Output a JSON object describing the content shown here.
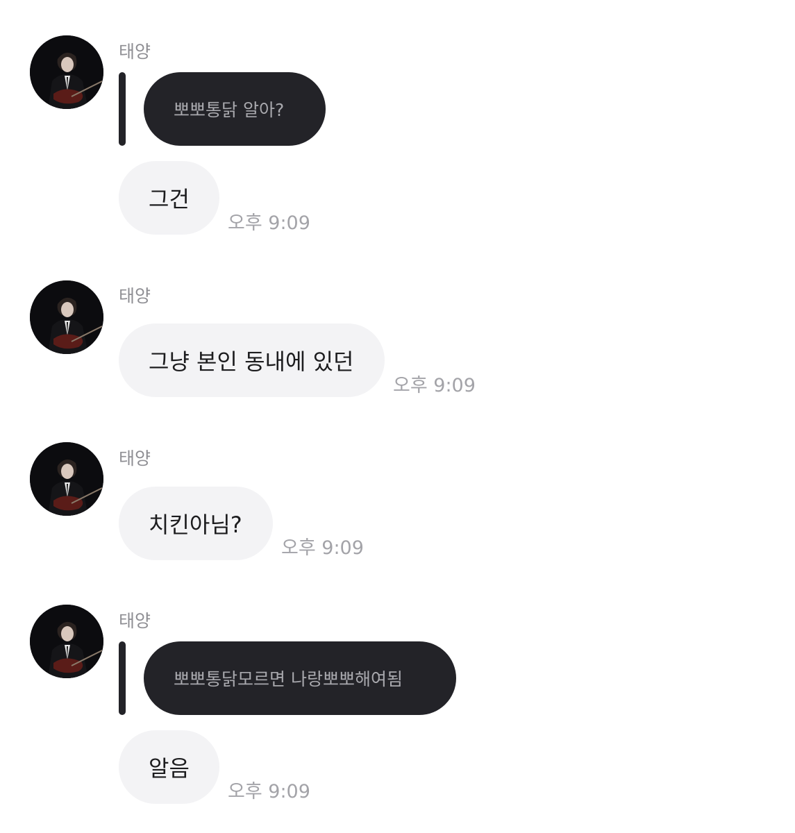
{
  "messages": [
    {
      "sender": "태양",
      "quote": "뽀뽀통닭 알아?",
      "text": "그건",
      "time": "오후 9:09"
    },
    {
      "sender": "태양",
      "text": "그냥 본인 동내에 있던",
      "time": "오후 9:09"
    },
    {
      "sender": "태양",
      "text": "치킨아님?",
      "time": "오후 9:09"
    },
    {
      "sender": "태양",
      "quote": "뽀뽀통닭모르면 나랑뽀뽀해여됨",
      "text": "알음",
      "time": "오후 9:09"
    }
  ],
  "colors": {
    "incoming_bubble": "#f3f3f5",
    "quote_bubble": "#232328",
    "timestamp": "#a3a3a8",
    "sender_name": "#8e8e93"
  },
  "icons": {
    "avatar": "profile-photo-guitarist"
  }
}
